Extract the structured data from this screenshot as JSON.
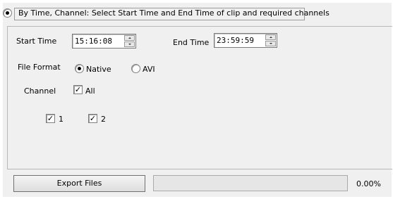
{
  "mode": {
    "by_time_channel_label": "By Time, Channel: Select Start Time and End Time of clip and required channels",
    "selected": true
  },
  "time": {
    "start_label": "Start Time",
    "start_value": "15:16:08",
    "end_label": "End Time",
    "end_value": "23:59:59"
  },
  "file_format": {
    "label": "File Format",
    "options": [
      {
        "label": "Native",
        "selected": true
      },
      {
        "label": "AVI",
        "selected": false
      }
    ]
  },
  "channel": {
    "label": "Channel",
    "all_label": "All",
    "all_checked": true,
    "items": [
      {
        "label": "1",
        "checked": true
      },
      {
        "label": "2",
        "checked": true
      }
    ]
  },
  "export": {
    "button_label": "Export Files",
    "progress_fraction": 0.0,
    "progress_text": "0.00%"
  },
  "glyphs": {
    "check": "✓"
  }
}
